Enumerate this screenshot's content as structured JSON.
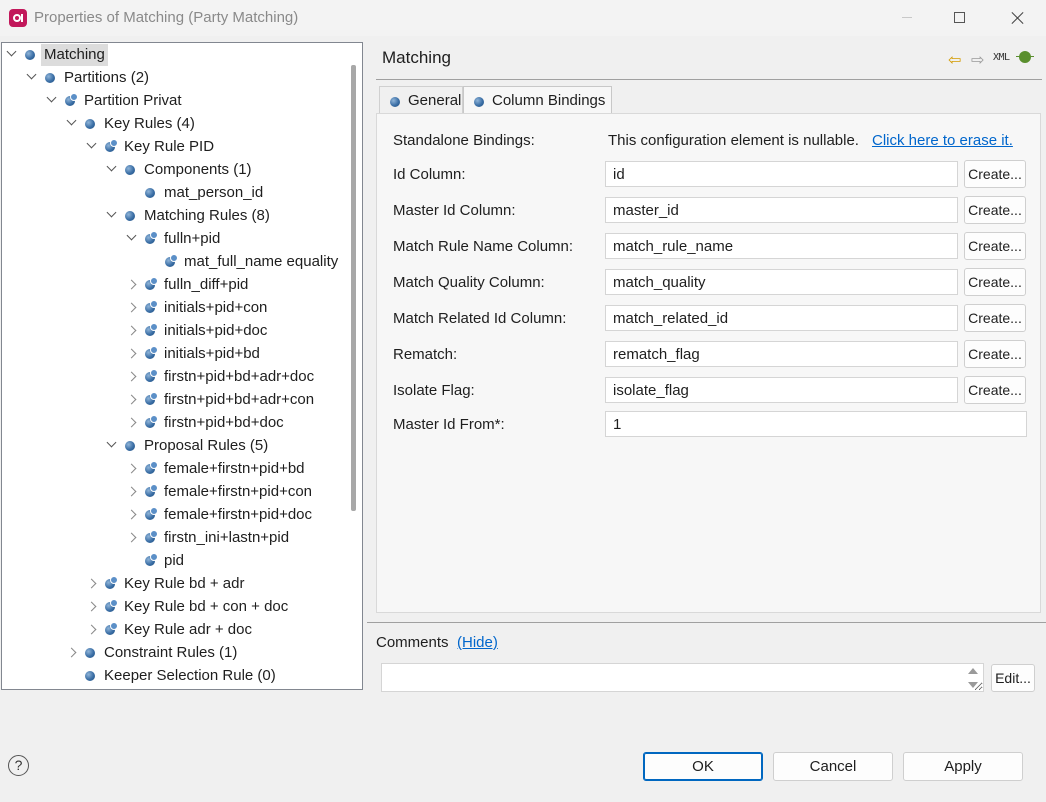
{
  "window": {
    "title": "Properties of Matching (Party Matching)"
  },
  "tree": {
    "items": [
      {
        "label": "Matching",
        "depth": 0,
        "expander": "down",
        "icon": "node",
        "selected": true
      },
      {
        "label": "Partitions (2)",
        "depth": 1,
        "expander": "down",
        "icon": "node"
      },
      {
        "label": "Partition Privat",
        "depth": 2,
        "expander": "down",
        "icon": "rule"
      },
      {
        "label": "Key Rules (4)",
        "depth": 3,
        "expander": "down",
        "icon": "node"
      },
      {
        "label": "Key Rule PID",
        "depth": 4,
        "expander": "down",
        "icon": "rule"
      },
      {
        "label": "Components (1)",
        "depth": 5,
        "expander": "down",
        "icon": "node"
      },
      {
        "label": "mat_person_id",
        "depth": 6,
        "expander": "none",
        "icon": "node"
      },
      {
        "label": "Matching Rules (8)",
        "depth": 5,
        "expander": "down",
        "icon": "node"
      },
      {
        "label": "fulln+pid",
        "depth": 6,
        "expander": "down",
        "icon": "rule"
      },
      {
        "label": "mat_full_name equality",
        "depth": 7,
        "expander": "none",
        "icon": "rule"
      },
      {
        "label": "fulln_diff+pid",
        "depth": 6,
        "expander": "right",
        "icon": "rule"
      },
      {
        "label": "initials+pid+con",
        "depth": 6,
        "expander": "right",
        "icon": "rule"
      },
      {
        "label": "initials+pid+doc",
        "depth": 6,
        "expander": "right",
        "icon": "rule"
      },
      {
        "label": "initials+pid+bd",
        "depth": 6,
        "expander": "right",
        "icon": "rule"
      },
      {
        "label": "firstn+pid+bd+adr+doc",
        "depth": 6,
        "expander": "right",
        "icon": "rule"
      },
      {
        "label": "firstn+pid+bd+adr+con",
        "depth": 6,
        "expander": "right",
        "icon": "rule"
      },
      {
        "label": "firstn+pid+bd+doc",
        "depth": 6,
        "expander": "right",
        "icon": "rule"
      },
      {
        "label": "Proposal Rules (5)",
        "depth": 5,
        "expander": "down",
        "icon": "node"
      },
      {
        "label": "female+firstn+pid+bd",
        "depth": 6,
        "expander": "right",
        "icon": "rule"
      },
      {
        "label": "female+firstn+pid+con",
        "depth": 6,
        "expander": "right",
        "icon": "rule"
      },
      {
        "label": "female+firstn+pid+doc",
        "depth": 6,
        "expander": "right",
        "icon": "rule"
      },
      {
        "label": "firstn_ini+lastn+pid",
        "depth": 6,
        "expander": "right",
        "icon": "rule"
      },
      {
        "label": "pid",
        "depth": 6,
        "expander": "none",
        "icon": "rule"
      },
      {
        "label": "Key Rule bd + adr",
        "depth": 4,
        "expander": "right",
        "icon": "rule"
      },
      {
        "label": "Key Rule bd + con + doc",
        "depth": 4,
        "expander": "right",
        "icon": "rule"
      },
      {
        "label": "Key Rule adr + doc",
        "depth": 4,
        "expander": "right",
        "icon": "rule"
      },
      {
        "label": "Constraint Rules (1)",
        "depth": 3,
        "expander": "right",
        "icon": "node"
      },
      {
        "label": "Keeper Selection Rule (0)",
        "depth": 3,
        "expander": "none",
        "icon": "node"
      }
    ]
  },
  "detail": {
    "title": "Matching",
    "xml_label": "XML",
    "tabs": [
      {
        "label": "General",
        "active": false
      },
      {
        "label": "Column Bindings",
        "active": true
      }
    ],
    "standalone": {
      "label": "Standalone Bindings:",
      "text": "This configuration element is nullable.",
      "link": "Click here to erase it."
    },
    "fields": [
      {
        "label": "Id Column:",
        "value": "id",
        "button": "Create..."
      },
      {
        "label": "Master Id Column:",
        "value": "master_id",
        "button": "Create..."
      },
      {
        "label": "Match Rule Name Column:",
        "value": "match_rule_name",
        "button": "Create..."
      },
      {
        "label": "Match Quality Column:",
        "value": "match_quality",
        "button": "Create..."
      },
      {
        "label": "Match Related Id Column:",
        "value": "match_related_id",
        "button": "Create..."
      },
      {
        "label": "Rematch:",
        "value": "rematch_flag",
        "button": "Create..."
      },
      {
        "label": "Isolate Flag:",
        "value": "isolate_flag",
        "button": "Create..."
      }
    ],
    "master_from": {
      "label": "Master Id From*:",
      "value": "1"
    }
  },
  "comments": {
    "label": "Comments",
    "hide_link": "(Hide)",
    "value": "",
    "edit_button": "Edit..."
  },
  "footer": {
    "help": "?",
    "ok": "OK",
    "cancel": "Cancel",
    "apply": "Apply"
  }
}
